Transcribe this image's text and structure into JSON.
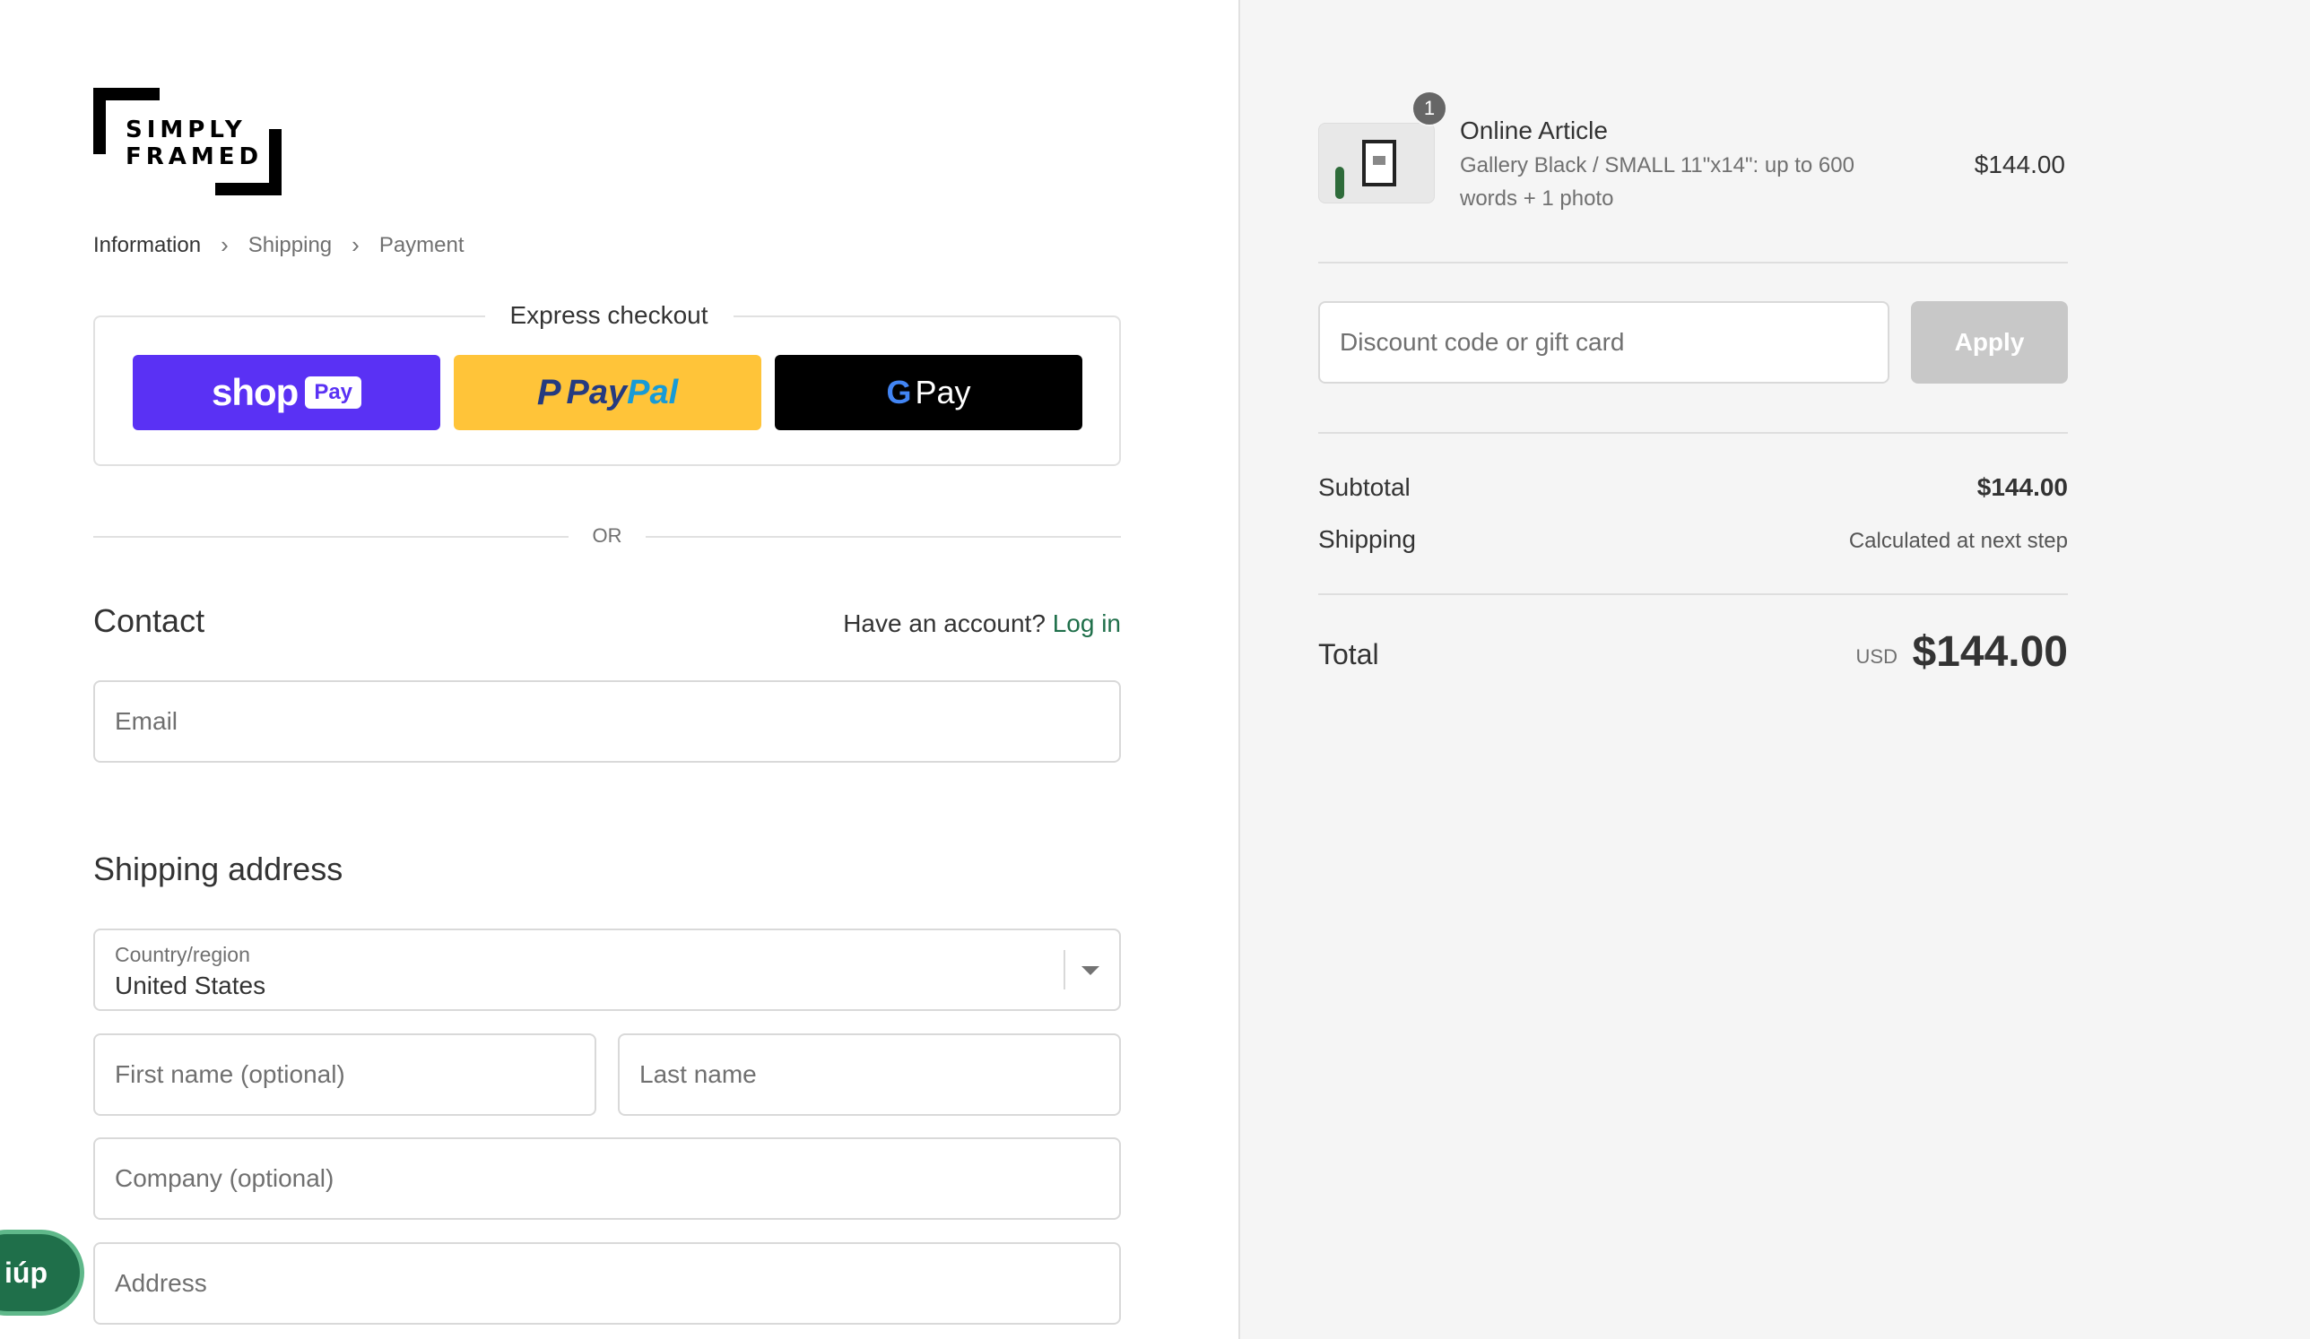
{
  "brand": {
    "line1": "SIMPLY",
    "line2": "FRAMED"
  },
  "breadcrumbs": [
    {
      "label": "Information"
    },
    {
      "label": "Shipping"
    },
    {
      "label": "Payment"
    }
  ],
  "express": {
    "title": "Express checkout",
    "shop_pay": {
      "word": "shop",
      "badge": "Pay"
    },
    "paypal": {
      "mark": "P",
      "word_a": "Pay",
      "word_b": "Pal"
    },
    "gpay": {
      "g": "G",
      "word": "Pay"
    }
  },
  "divider_or": "OR",
  "contact": {
    "title": "Contact",
    "account_prompt": "Have an account?",
    "login_label": "Log in",
    "email_placeholder": "Email"
  },
  "shipping": {
    "title": "Shipping address",
    "country_label": "Country/region",
    "country_value": "United States",
    "first_name_placeholder": "First name (optional)",
    "last_name_placeholder": "Last name",
    "company_placeholder": "Company (optional)",
    "address_placeholder": "Address"
  },
  "help_button": "iúp",
  "order": {
    "item": {
      "quantity": "1",
      "name": "Online Article",
      "description": "Gallery Black / SMALL 11\"x14\": up to 600 words + 1 photo",
      "price": "$144.00"
    },
    "discount_placeholder": "Discount code or gift card",
    "apply_label": "Apply",
    "subtotal_label": "Subtotal",
    "subtotal_value": "$144.00",
    "shipping_label": "Shipping",
    "shipping_value": "Calculated at next step",
    "total_label": "Total",
    "currency": "USD",
    "total_value": "$144.00"
  },
  "colors": {
    "shop_pay": "#5a31f4",
    "paypal": "#ffc439",
    "gpay": "#000000",
    "link": "#1f6f4a",
    "apply_disabled": "#c8c8c8",
    "sidebar_bg": "#f5f5f5"
  }
}
